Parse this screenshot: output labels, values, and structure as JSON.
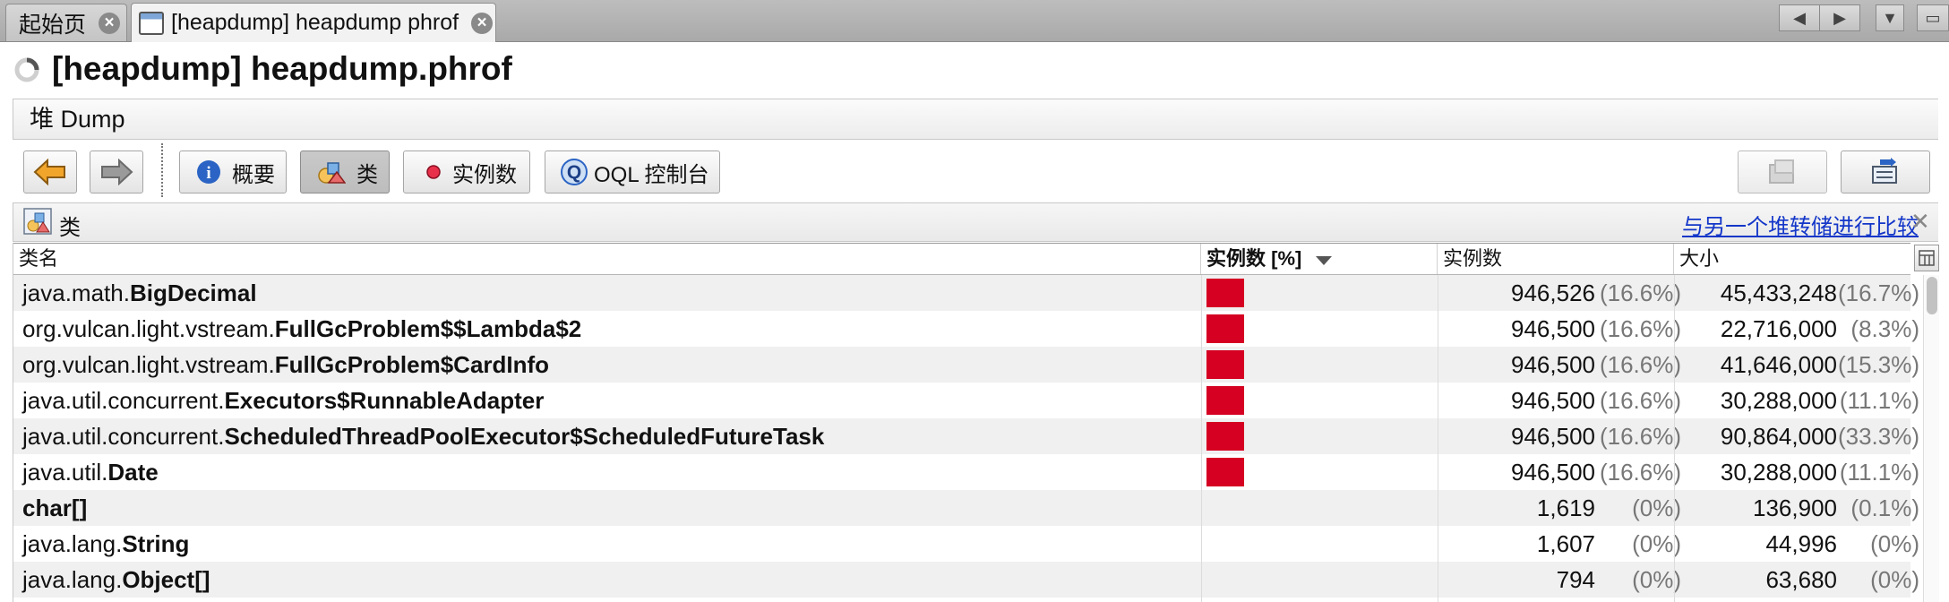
{
  "tabs": [
    {
      "label": "起始页",
      "active": false
    },
    {
      "label": "[heapdump] heapdump phrof",
      "active": true
    }
  ],
  "title": "[heapdump] heapdump.phrof",
  "heap_header": "堆 Dump",
  "toolbar": {
    "summary": "概要",
    "classes": "类",
    "instances": "实例数",
    "oql": "OQL 控制台"
  },
  "classes_panel": {
    "title": "类",
    "compare_link": "与另一个堆转储进行比较"
  },
  "table": {
    "columns": {
      "name": "类名",
      "instances_pct": "实例数 [%]",
      "instances": "实例数",
      "size": "大小"
    },
    "sort_icon": "sort-descending-icon",
    "rows": [
      {
        "pkg": "java.math.",
        "cls": "BigDecimal",
        "count": "946,526",
        "count_pct": "(16.6%)",
        "size": "45,433,248",
        "size_pct": "(16.7%)",
        "pct": 16.6
      },
      {
        "pkg": "org.vulcan.light.vstream.",
        "cls": "FullGcProblem$$Lambda$2",
        "count": "946,500",
        "count_pct": "(16.6%)",
        "size": "22,716,000",
        "size_pct": "(8.3%)",
        "pct": 16.6
      },
      {
        "pkg": "org.vulcan.light.vstream.",
        "cls": "FullGcProblem$CardInfo",
        "count": "946,500",
        "count_pct": "(16.6%)",
        "size": "41,646,000",
        "size_pct": "(15.3%)",
        "pct": 16.6
      },
      {
        "pkg": "java.util.concurrent.",
        "cls": "Executors$RunnableAdapter",
        "count": "946,500",
        "count_pct": "(16.6%)",
        "size": "30,288,000",
        "size_pct": "(11.1%)",
        "pct": 16.6
      },
      {
        "pkg": "java.util.concurrent.",
        "cls": "ScheduledThreadPoolExecutor$ScheduledFutureTask",
        "count": "946,500",
        "count_pct": "(16.6%)",
        "size": "90,864,000",
        "size_pct": "(33.3%)",
        "pct": 16.6
      },
      {
        "pkg": "java.util.",
        "cls": "Date",
        "count": "946,500",
        "count_pct": "(16.6%)",
        "size": "30,288,000",
        "size_pct": "(11.1%)",
        "pct": 16.6
      },
      {
        "pkg": "",
        "cls": "char[]",
        "count": "1,619",
        "count_pct": "(0%)",
        "size": "136,900",
        "size_pct": "(0.1%)",
        "pct": 0
      },
      {
        "pkg": "java.lang.",
        "cls": "String",
        "count": "1,607",
        "count_pct": "(0%)",
        "size": "44,996",
        "size_pct": "(0%)",
        "pct": 0
      },
      {
        "pkg": "java.lang.",
        "cls": "Object[]",
        "count": "794",
        "count_pct": "(0%)",
        "size": "63,680",
        "size_pct": "(0%)",
        "pct": 0
      }
    ]
  },
  "colors": {
    "bar": "#d50022",
    "link": "#1336c9"
  }
}
